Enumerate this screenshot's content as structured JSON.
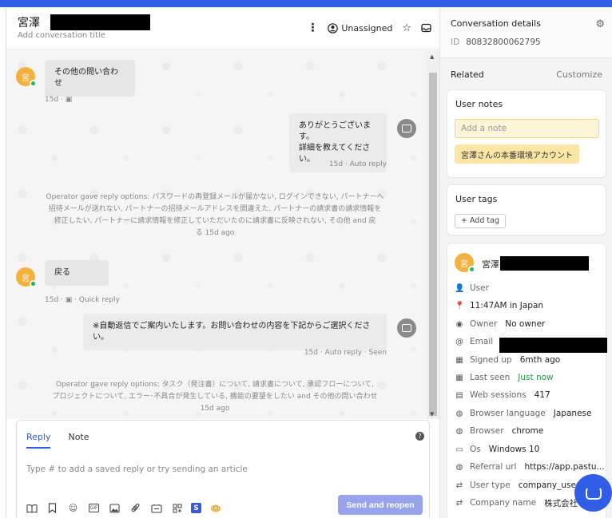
{
  "header": {
    "name": "宮澤",
    "subtitle": "Add conversation title",
    "assignee": "Unassigned"
  },
  "thread": {
    "msg1": {
      "avatar": "宮",
      "text": "その他の問い合わせ",
      "meta": "15d ·"
    },
    "msg2": {
      "line1": "ありがとうございます。",
      "line2": "詳細を教えてください。",
      "meta": "15d · Auto reply"
    },
    "sys1": {
      "line1": "Operator gave reply options: パスワードの再登録メールが届かない, ログインできない, パートナーへ",
      "line2": "招待メールが送れない, パートナーの招待メールアドレスを間違えた, パートナーの請求書の請求情報を",
      "line3": "修正したい, パートナーに請求情報を修正していただいたのに請求書に反映されない, その他 and 戻",
      "line4": "る 15d ago"
    },
    "msg3": {
      "avatar": "宮",
      "text": "戻る",
      "meta": "15d ·",
      "meta2": "· Quick reply"
    },
    "msg4": {
      "text": "※自動返信でご案内いたします。お問い合わせの内容を下記からご選択ください。",
      "meta": "15d · Auto reply · Seen"
    },
    "sys2": {
      "line1": "Operator gave reply options: タスク（発注書）について, 請求書について, 承認フローについて,",
      "line2": "プロジェクトについて, エラー･不具合が発生している, 機能の要望をしたい and その他の問い合わせ",
      "line3": "15d ago"
    }
  },
  "composer": {
    "tab_reply": "Reply",
    "tab_note": "Note",
    "help": "?",
    "placeholder": "Type # to add a saved reply or try sending an article",
    "send_label": "Send and reopen",
    "gif": "GIF",
    "s_icon": "S"
  },
  "sidebar": {
    "title": "Conversation details",
    "id_label": "ID",
    "id_value": "80832800062795",
    "related": "Related",
    "customize": "Customize",
    "user_notes_title": "User notes",
    "note_placeholder": "Add a note",
    "note_text": "宮澤さんの本番環境アカウント",
    "user_tags_title": "User tags",
    "add_tag": "+ Add tag",
    "profile": {
      "avatar": "宮",
      "name": "宮澤",
      "type": "User",
      "local_time": "11:47AM in Japan",
      "owner_label": "Owner",
      "owner_value": "No owner",
      "email_label": "Email",
      "signed_up_label": "Signed up",
      "signed_up_value": "6mth ago",
      "last_seen_label": "Last seen",
      "last_seen_value": "Just now",
      "web_sessions_label": "Web sessions",
      "web_sessions_value": "417",
      "browser_language_label": "Browser language",
      "browser_language_value": "Japanese",
      "browser_label": "Browser",
      "browser_value": "chrome",
      "os_label": "Os",
      "os_value": "Windows 10",
      "referral_label": "Referral url",
      "referral_value": "https://app.pastu...",
      "user_type_label": "User type",
      "user_type_value": "company_user",
      "company_label": "Company name",
      "company_value": "株式会社"
    }
  },
  "colors": {
    "accent": "#2f5de6",
    "send_button": "#97a4ec",
    "online": "#1fb85a",
    "note": "#fbe6a6"
  }
}
